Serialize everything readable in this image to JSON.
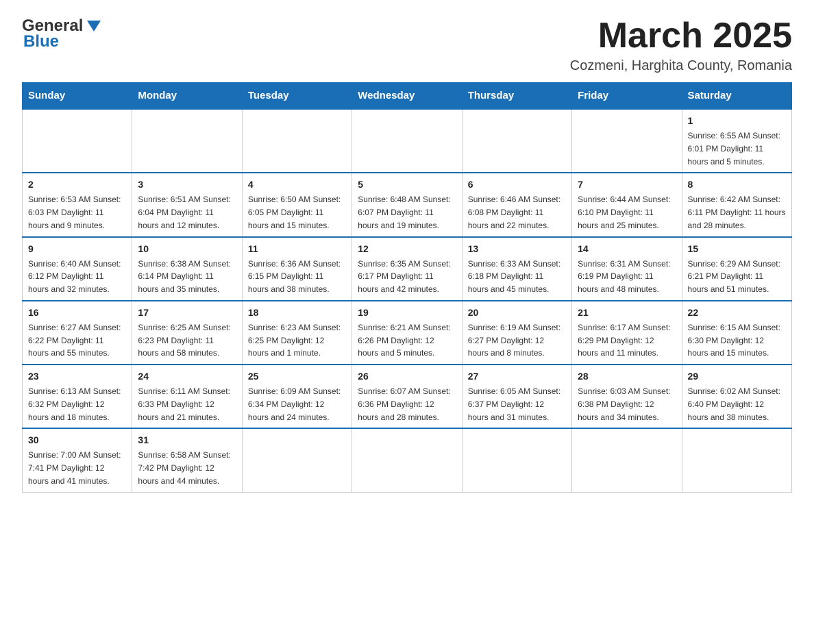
{
  "header": {
    "logo_general": "General",
    "logo_blue": "Blue",
    "month_title": "March 2025",
    "location": "Cozmeni, Harghita County, Romania"
  },
  "days_of_week": [
    "Sunday",
    "Monday",
    "Tuesday",
    "Wednesday",
    "Thursday",
    "Friday",
    "Saturday"
  ],
  "weeks": [
    [
      {
        "day": "",
        "info": ""
      },
      {
        "day": "",
        "info": ""
      },
      {
        "day": "",
        "info": ""
      },
      {
        "day": "",
        "info": ""
      },
      {
        "day": "",
        "info": ""
      },
      {
        "day": "",
        "info": ""
      },
      {
        "day": "1",
        "info": "Sunrise: 6:55 AM\nSunset: 6:01 PM\nDaylight: 11 hours\nand 5 minutes."
      }
    ],
    [
      {
        "day": "2",
        "info": "Sunrise: 6:53 AM\nSunset: 6:03 PM\nDaylight: 11 hours\nand 9 minutes."
      },
      {
        "day": "3",
        "info": "Sunrise: 6:51 AM\nSunset: 6:04 PM\nDaylight: 11 hours\nand 12 minutes."
      },
      {
        "day": "4",
        "info": "Sunrise: 6:50 AM\nSunset: 6:05 PM\nDaylight: 11 hours\nand 15 minutes."
      },
      {
        "day": "5",
        "info": "Sunrise: 6:48 AM\nSunset: 6:07 PM\nDaylight: 11 hours\nand 19 minutes."
      },
      {
        "day": "6",
        "info": "Sunrise: 6:46 AM\nSunset: 6:08 PM\nDaylight: 11 hours\nand 22 minutes."
      },
      {
        "day": "7",
        "info": "Sunrise: 6:44 AM\nSunset: 6:10 PM\nDaylight: 11 hours\nand 25 minutes."
      },
      {
        "day": "8",
        "info": "Sunrise: 6:42 AM\nSunset: 6:11 PM\nDaylight: 11 hours\nand 28 minutes."
      }
    ],
    [
      {
        "day": "9",
        "info": "Sunrise: 6:40 AM\nSunset: 6:12 PM\nDaylight: 11 hours\nand 32 minutes."
      },
      {
        "day": "10",
        "info": "Sunrise: 6:38 AM\nSunset: 6:14 PM\nDaylight: 11 hours\nand 35 minutes."
      },
      {
        "day": "11",
        "info": "Sunrise: 6:36 AM\nSunset: 6:15 PM\nDaylight: 11 hours\nand 38 minutes."
      },
      {
        "day": "12",
        "info": "Sunrise: 6:35 AM\nSunset: 6:17 PM\nDaylight: 11 hours\nand 42 minutes."
      },
      {
        "day": "13",
        "info": "Sunrise: 6:33 AM\nSunset: 6:18 PM\nDaylight: 11 hours\nand 45 minutes."
      },
      {
        "day": "14",
        "info": "Sunrise: 6:31 AM\nSunset: 6:19 PM\nDaylight: 11 hours\nand 48 minutes."
      },
      {
        "day": "15",
        "info": "Sunrise: 6:29 AM\nSunset: 6:21 PM\nDaylight: 11 hours\nand 51 minutes."
      }
    ],
    [
      {
        "day": "16",
        "info": "Sunrise: 6:27 AM\nSunset: 6:22 PM\nDaylight: 11 hours\nand 55 minutes."
      },
      {
        "day": "17",
        "info": "Sunrise: 6:25 AM\nSunset: 6:23 PM\nDaylight: 11 hours\nand 58 minutes."
      },
      {
        "day": "18",
        "info": "Sunrise: 6:23 AM\nSunset: 6:25 PM\nDaylight: 12 hours\nand 1 minute."
      },
      {
        "day": "19",
        "info": "Sunrise: 6:21 AM\nSunset: 6:26 PM\nDaylight: 12 hours\nand 5 minutes."
      },
      {
        "day": "20",
        "info": "Sunrise: 6:19 AM\nSunset: 6:27 PM\nDaylight: 12 hours\nand 8 minutes."
      },
      {
        "day": "21",
        "info": "Sunrise: 6:17 AM\nSunset: 6:29 PM\nDaylight: 12 hours\nand 11 minutes."
      },
      {
        "day": "22",
        "info": "Sunrise: 6:15 AM\nSunset: 6:30 PM\nDaylight: 12 hours\nand 15 minutes."
      }
    ],
    [
      {
        "day": "23",
        "info": "Sunrise: 6:13 AM\nSunset: 6:32 PM\nDaylight: 12 hours\nand 18 minutes."
      },
      {
        "day": "24",
        "info": "Sunrise: 6:11 AM\nSunset: 6:33 PM\nDaylight: 12 hours\nand 21 minutes."
      },
      {
        "day": "25",
        "info": "Sunrise: 6:09 AM\nSunset: 6:34 PM\nDaylight: 12 hours\nand 24 minutes."
      },
      {
        "day": "26",
        "info": "Sunrise: 6:07 AM\nSunset: 6:36 PM\nDaylight: 12 hours\nand 28 minutes."
      },
      {
        "day": "27",
        "info": "Sunrise: 6:05 AM\nSunset: 6:37 PM\nDaylight: 12 hours\nand 31 minutes."
      },
      {
        "day": "28",
        "info": "Sunrise: 6:03 AM\nSunset: 6:38 PM\nDaylight: 12 hours\nand 34 minutes."
      },
      {
        "day": "29",
        "info": "Sunrise: 6:02 AM\nSunset: 6:40 PM\nDaylight: 12 hours\nand 38 minutes."
      }
    ],
    [
      {
        "day": "30",
        "info": "Sunrise: 7:00 AM\nSunset: 7:41 PM\nDaylight: 12 hours\nand 41 minutes."
      },
      {
        "day": "31",
        "info": "Sunrise: 6:58 AM\nSunset: 7:42 PM\nDaylight: 12 hours\nand 44 minutes."
      },
      {
        "day": "",
        "info": ""
      },
      {
        "day": "",
        "info": ""
      },
      {
        "day": "",
        "info": ""
      },
      {
        "day": "",
        "info": ""
      },
      {
        "day": "",
        "info": ""
      }
    ]
  ]
}
